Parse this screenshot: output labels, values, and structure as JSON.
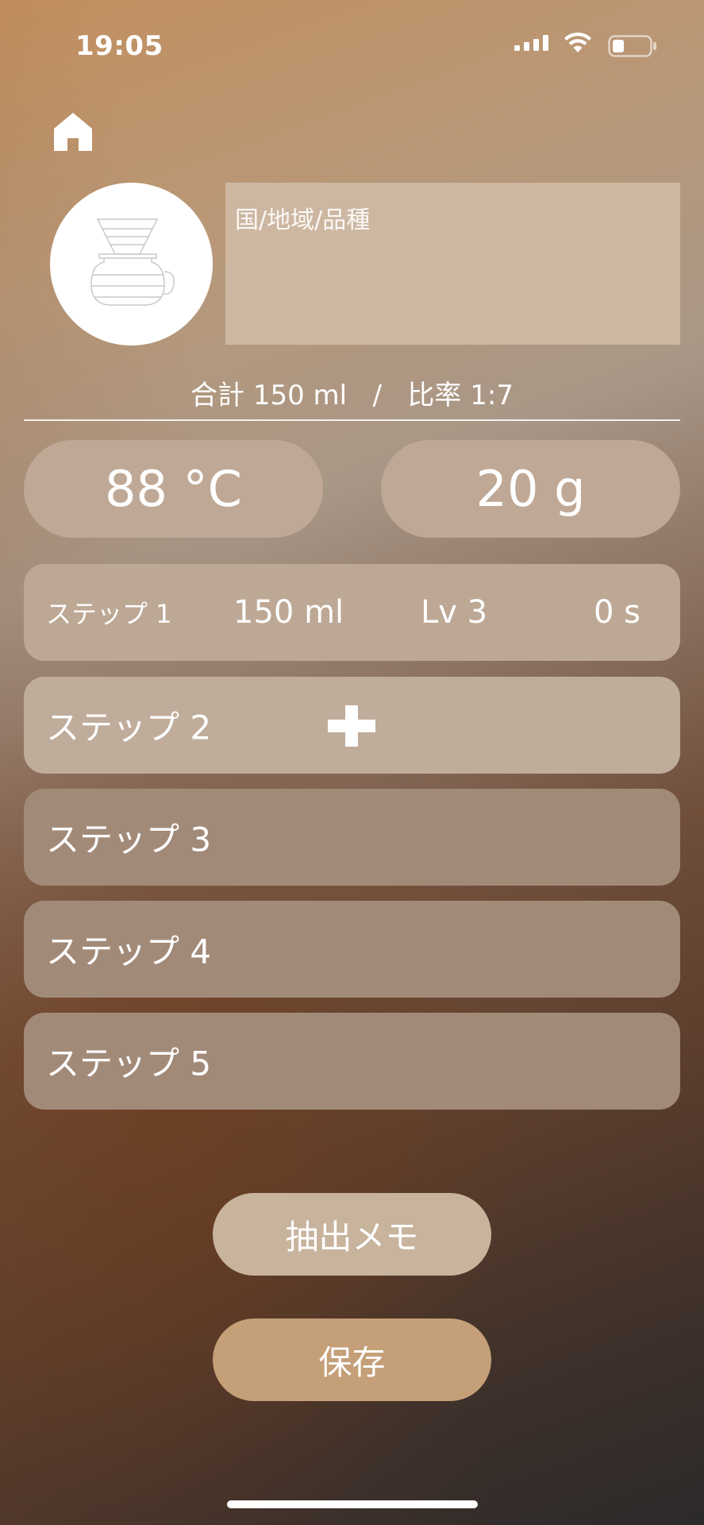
{
  "status_bar": {
    "time": "19:05",
    "icons": [
      "cellular-signal-icon",
      "wifi-icon",
      "battery-icon"
    ]
  },
  "nav": {
    "home_icon": "home-icon"
  },
  "header": {
    "dripper_icon": "pour-over-dripper-icon",
    "origin_placeholder": "国/地域/品種",
    "origin_value": ""
  },
  "summary": {
    "text": "合計 150 ml   /   比率 1:7"
  },
  "settings": {
    "temperature": "88 °C",
    "weight": "20 g"
  },
  "steps": [
    {
      "label": "ステップ 1",
      "amount": "150 ml",
      "level": "Lv 3",
      "time": "0 s"
    },
    {
      "label": "ステップ 2",
      "action_icon": "plus-icon"
    },
    {
      "label": "ステップ 3"
    },
    {
      "label": "ステップ 4"
    },
    {
      "label": "ステップ 5"
    }
  ],
  "actions": {
    "memo_label": "抽出メモ",
    "save_label": "保存"
  },
  "colors": {
    "pill_bg": "#bfa996",
    "step_active_bg": "#bda895",
    "step_inactive_bg": "#a28a79",
    "memo_button_bg": "#c8b39d",
    "save_button_bg": "#c49f78",
    "field_bg": "#cdb7a1"
  }
}
